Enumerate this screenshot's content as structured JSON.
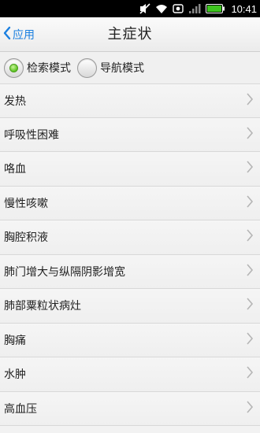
{
  "status_bar": {
    "time": "10:41",
    "icons": [
      "mute-icon",
      "wifi-icon",
      "alarm-icon",
      "signal-icon",
      "battery-icon"
    ]
  },
  "nav": {
    "back_label": "应用",
    "title": "主症状"
  },
  "modes": {
    "search_label": "检索模式",
    "navigate_label": "导航模式",
    "selected": "search"
  },
  "symptoms": [
    {
      "label": "发热"
    },
    {
      "label": "呼吸性困难"
    },
    {
      "label": "咯血"
    },
    {
      "label": "慢性咳嗽"
    },
    {
      "label": "胸腔积液"
    },
    {
      "label": "肺门增大与纵隔阴影增宽"
    },
    {
      "label": "肺部粟粒状病灶"
    },
    {
      "label": "胸痛"
    },
    {
      "label": "水肿"
    },
    {
      "label": "高血压"
    }
  ],
  "colors": {
    "accent": "#1a7fe0",
    "radio_selected": "#5cc322",
    "battery": "#3ec41f"
  }
}
